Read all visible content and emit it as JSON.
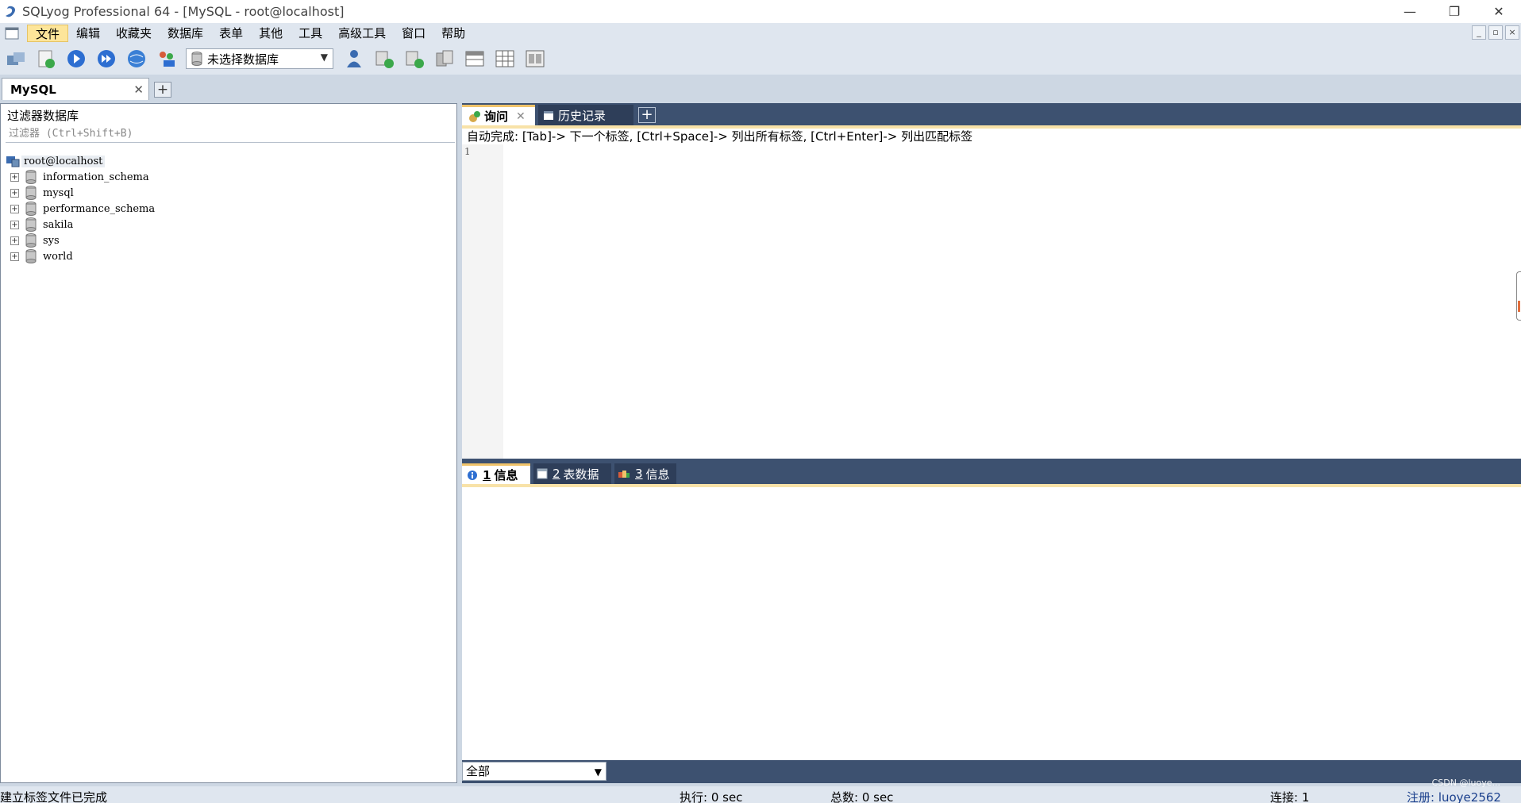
{
  "window": {
    "title": "SQLyog Professional 64 - [MySQL - root@localhost]",
    "minimize": "—",
    "restore": "❐",
    "close": "✕"
  },
  "menu": {
    "items": [
      "文件",
      "编辑",
      "收藏夹",
      "数据库",
      "表单",
      "其他",
      "工具",
      "高级工具",
      "窗口",
      "帮助"
    ],
    "mdi_minimize": "_",
    "mdi_restore": "▫",
    "mdi_close": "×"
  },
  "toolbar": {
    "db_select_value": "未选择数据库"
  },
  "connection_tab": {
    "label": "MySQL",
    "close": "✕",
    "add": "+"
  },
  "object_browser": {
    "title": "过滤器数据库",
    "filter_placeholder": "过滤器 (Ctrl+Shift+B)",
    "root": "root@localhost",
    "databases": [
      "information_schema",
      "mysql",
      "performance_schema",
      "sakila",
      "sys",
      "world"
    ]
  },
  "query_tabs": {
    "query_label": "询问",
    "query_close": "✕",
    "history_label": "历史记录",
    "add": "+"
  },
  "editor": {
    "autocomplete_hint": "自动完成: [Tab]-> 下一个标签, [Ctrl+Space]-> 列出所有标签, [Ctrl+Enter]-> 列出匹配标签",
    "line_number": "1"
  },
  "result_tabs": {
    "tab1_num": "1",
    "tab1_label": "信息",
    "tab2_num": "2",
    "tab2_label": "表数据",
    "tab3_num": "3",
    "tab3_label": "信息"
  },
  "result_filter": {
    "value": "全部"
  },
  "statusbar": {
    "message": "建立标签文件已完成",
    "exec": "执行: 0 sec",
    "total": "总数: 0 sec",
    "connections": "连接: 1",
    "register": "注册: luoye2562"
  },
  "watermark": "CSDN @luoye...",
  "colors": {
    "panel_dark": "#3d5170",
    "tab_active_accent": "#f0c36a",
    "menu_active": "#fde59a"
  }
}
